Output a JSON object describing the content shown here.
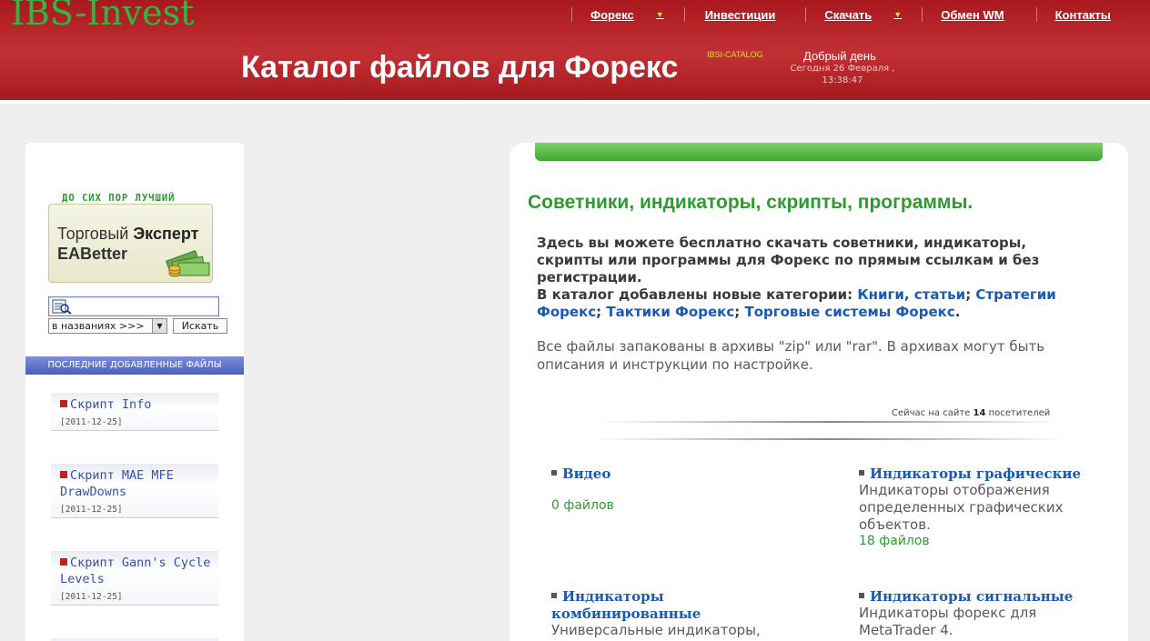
{
  "header": {
    "logo": "IBS-Invest",
    "title": "Каталог файлов для Форекс",
    "catalog_tag": "IBSI-CATALOG",
    "greeting": "Добрый день",
    "dateline": "Сегодня 26 Февраля , 13:38:47"
  },
  "nav": [
    {
      "label": "Форекс",
      "has_dropdown": true
    },
    {
      "label": "Инвестиции",
      "has_dropdown": false
    },
    {
      "label": "Скачать",
      "has_dropdown": true
    },
    {
      "label": "Обмен WM",
      "has_dropdown": false
    },
    {
      "label": "Контакты",
      "has_dropdown": false
    }
  ],
  "sidebar": {
    "promo_caption": "ДО СИХ ПОР ЛУЧШИЙ",
    "promo_line1_a": "Торговый",
    "promo_line1_b": "Эксперт",
    "promo_line2": "EABetter",
    "search_placeholder": "",
    "search_scope": "в названиях >>>",
    "search_button": "Искать",
    "recent_header": "ПОСЛЕДНИЕ ДОБАВЛЕННЫЕ ФАЙЛЫ",
    "recent": [
      {
        "title": "Скрипт Info",
        "date": "[2011-12-25]"
      },
      {
        "title": "Скрипт MAE MFE DrawDowns",
        "date": "[2011-12-25]"
      },
      {
        "title": "Скрипт Gann's Cycle Levels",
        "date": "[2011-12-25]"
      }
    ]
  },
  "main": {
    "heading": "Советники, индикаторы, скрипты, программы.",
    "intro_text": "Здесь вы можете бесплатно скачать советники, индикаторы, скрипты или программы для Форекс по прямым ссылкам и без регистрации.",
    "intro_added": "В каталог добавлены новые категории:",
    "new_categories": [
      "Книги, статьи",
      "Стратегии Форекс",
      "Тактики Форекс",
      "Торговые системы Форекс"
    ],
    "note": "Все файлы запакованы в архивы \"zip\" или \"rar\". В архивах могут быть описания и инструкции по настройке.",
    "visitors_prefix": "Сейчас на сайте",
    "visitors_count": "14",
    "visitors_suffix": "посетителей",
    "categories": [
      {
        "title": "Видео",
        "desc": "",
        "count": "0 файлов"
      },
      {
        "title": "Индикаторы графические",
        "desc": "Индикаторы отображения определенных графических объектов.",
        "count": "18 файлов"
      },
      {
        "title": "Индикаторы комбинированные",
        "desc": "Универсальные индикаторы, объединяющие несколько",
        "count": ""
      },
      {
        "title": "Индикаторы сигнальные",
        "desc": "Индикаторы форекс для MetaTrader 4.",
        "count": ""
      }
    ]
  },
  "colors": {
    "header_red": "#b8262a",
    "logo_green": "#3cb043",
    "heading_green": "#2f9a2f",
    "link_blue": "#1a5ab0"
  }
}
